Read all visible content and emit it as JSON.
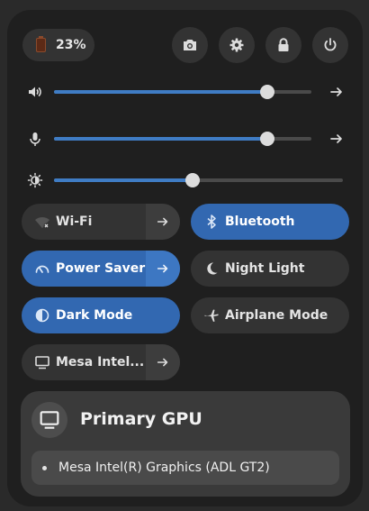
{
  "battery": {
    "percent_label": "23%",
    "level": 0.23,
    "color": "#5c2a16"
  },
  "top_buttons": [
    "camera-icon",
    "gear-icon",
    "lock-icon",
    "power-icon"
  ],
  "volume": {
    "level": 0.83,
    "icon": "speaker-icon"
  },
  "microphone": {
    "level": 0.83,
    "icon": "microphone-icon"
  },
  "brightness": {
    "level": 0.48,
    "icon": "brightness-icon"
  },
  "toggles": {
    "wifi": {
      "label": "Wi-Fi",
      "active": false
    },
    "bluetooth": {
      "label": "Bluetooth",
      "active": true
    },
    "power_saver": {
      "label": "Power Saver",
      "active": true
    },
    "night_light": {
      "label": "Night Light",
      "active": false
    },
    "dark_mode": {
      "label": "Dark Mode",
      "active": true
    },
    "airplane_mode": {
      "label": "Airplane Mode",
      "active": false
    },
    "gpu": {
      "label": "Mesa Intel...",
      "active": false
    }
  },
  "gpu_menu": {
    "title": "Primary GPU",
    "items": [
      "Mesa Intel(R) Graphics (ADL GT2)"
    ]
  },
  "colors": {
    "accent": "#3268b1",
    "panel": "#1f1f1f",
    "tile": "#333333"
  }
}
